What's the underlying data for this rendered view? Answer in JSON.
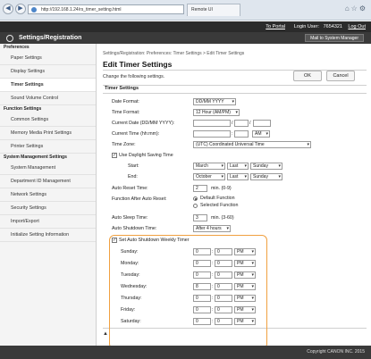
{
  "browser": {
    "url": "http://192.168.1.24/rs_timer_setting.html",
    "tab_title": "Remote UI",
    "controls": [
      "back-icon",
      "forward-icon",
      "refresh-icon"
    ]
  },
  "header": {
    "to_portal": "To Portal",
    "login_user_label": "Login User:",
    "login_user_value": "7654321",
    "log_out": "Log Out",
    "brand": "Settings/Registration",
    "mail_button": "Mail to System Manager"
  },
  "sidebar": {
    "sections": [
      {
        "title": "Preferences",
        "items": [
          "Paper Settings",
          "Display Settings",
          "Timer Settings",
          "Sound Volume Control"
        ]
      },
      {
        "title": "Function Settings",
        "items": [
          "Common Settings",
          "Memory Media Print Settings",
          "Printer Settings"
        ]
      },
      {
        "title": "System Management Settings",
        "items": [
          "System Management",
          "Department ID Management",
          "Network Settings",
          "Security Settings",
          "Import/Export",
          "Initialize Setting Information"
        ]
      }
    ],
    "selected": "Timer Settings"
  },
  "main": {
    "breadcrumb": "Settings/Registration: Preferences: Timer Settings > Edit Timer Settings",
    "title": "Edit Timer Settings",
    "hint": "Change the following settings.",
    "ok": "OK",
    "cancel": "Cancel",
    "section": "Timer Settings",
    "date_format": {
      "label": "Date Format:",
      "value": "DD/MM YYYY"
    },
    "time_format": {
      "label": "Time Format:",
      "value": "12 Hour (AM/PM)"
    },
    "current_date": {
      "label": "Current Date (DD/MM YYYY):",
      "sep": "/"
    },
    "current_time": {
      "label": "Current Time (hh:mm):",
      "sep": ":",
      "ampm": "AM"
    },
    "time_zone": {
      "label": "Time Zone:",
      "value": "(UTC) Coordinated Universal Time"
    },
    "dst": {
      "label": "Use Daylight Saving Time",
      "start_label": "Start:",
      "start": [
        "March",
        "Last",
        "Sunday"
      ],
      "end_label": "End:",
      "end": [
        "October",
        "Last",
        "Sunday"
      ]
    },
    "auto_reset": {
      "label": "Auto Reset Time:",
      "value": "2",
      "unit": "min. (0-9)"
    },
    "after_auto_reset": {
      "label": "Function After Auto Reset:",
      "opt1": "Default Function",
      "opt2": "Selected Function"
    },
    "auto_sleep": {
      "label": "Auto Sleep Time:",
      "value": "3",
      "unit": "min. (3-60)"
    },
    "auto_shutdown": {
      "label": "Auto Shutdown Time:",
      "value": "After 4 hours"
    },
    "weekly": {
      "label": "Set Auto Shutdown Weekly Timer",
      "days": [
        {
          "name": "Sunday:",
          "hour": "0",
          "min": "0",
          "ampm": "PM"
        },
        {
          "name": "Monday:",
          "hour": "0",
          "min": "0",
          "ampm": "PM"
        },
        {
          "name": "Tuesday:",
          "hour": "0",
          "min": "0",
          "ampm": "PM"
        },
        {
          "name": "Wednesday:",
          "hour": "8",
          "min": "0",
          "ampm": "PM"
        },
        {
          "name": "Thursday:",
          "hour": "0",
          "min": "0",
          "ampm": "PM"
        },
        {
          "name": "Friday:",
          "hour": "0",
          "min": "0",
          "ampm": "PM"
        },
        {
          "name": "Saturday:",
          "hour": "0",
          "min": "0",
          "ampm": "PM"
        }
      ],
      "sep": ":"
    },
    "to_top": "▲"
  },
  "footer": {
    "copyright": "Copyright CANON INC. 2015"
  },
  "colors": {
    "highlight": "#f0a040",
    "header_bg": "#2b2b2b"
  }
}
